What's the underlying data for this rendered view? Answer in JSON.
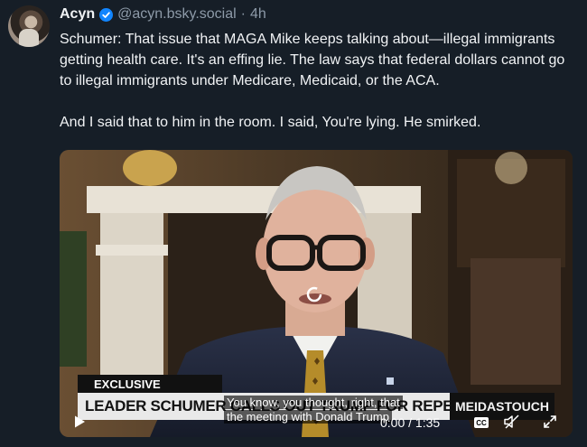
{
  "post": {
    "author_name": "Acyn",
    "handle": "@acyn.bsky.social",
    "separator": "·",
    "time": "4h",
    "paragraphs": [
      "Schumer: That issue that MAGA Mike keeps talking about—illegal immigrants getting health care. It's an effing lie. The law says that federal dollars cannot go to illegal immigrants under Medicare, Medicaid, or the ACA.",
      "And I said that to him in the room. I said, You're lying. He smirked."
    ]
  },
  "video": {
    "exclusive_label": "EXCLUSIVE",
    "headline": "LEADER SCHUMER CALLS OUT TRUMP FOR REPEATING LIE AT MEETING",
    "brand": "MEIDASTOUCH",
    "caption_lines": [
      "You know, you thought, right, that",
      "the meeting with Donald Trump"
    ],
    "timecode": "0:00 / 1:35",
    "cc_label": "CC"
  },
  "icons": {
    "verified": "verified-check-icon",
    "play": "play-icon",
    "cc": "closed-captions-icon",
    "mute": "mute-icon",
    "fullscreen": "fullscreen-icon"
  },
  "colors": {
    "background": "#161e27",
    "text": "#f1f3f5",
    "muted": "#8d9aa8",
    "verified": "#1185fe"
  }
}
